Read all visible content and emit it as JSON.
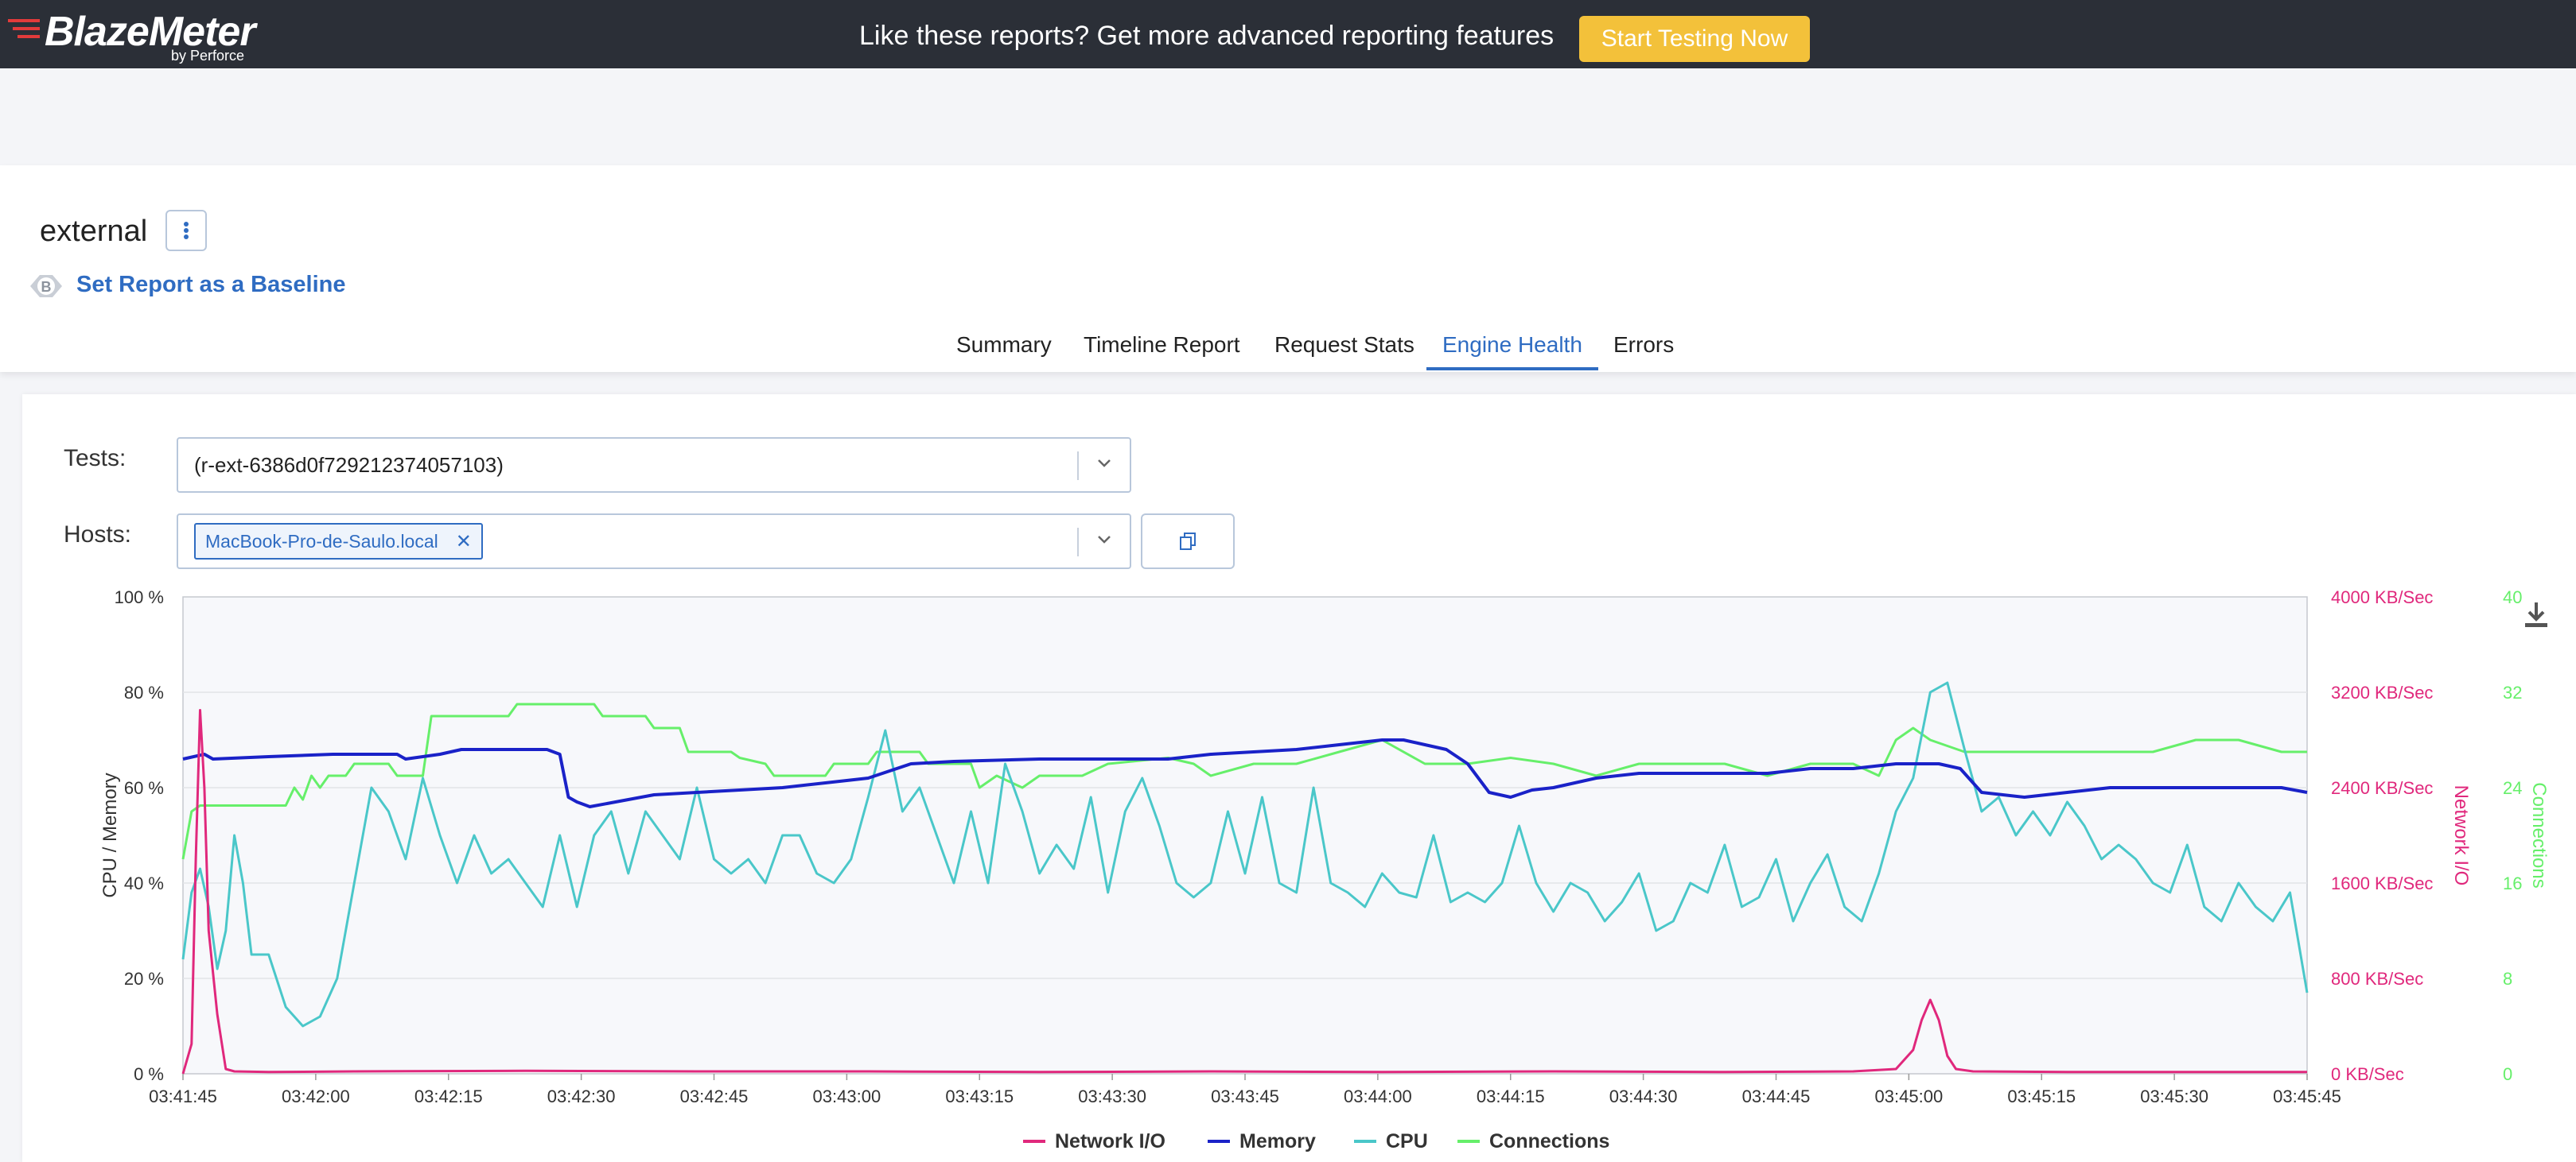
{
  "topbar": {
    "logo_text": "BlazeMeter",
    "logo_sub": "by Perforce",
    "promo_text": "Like these reports? Get more advanced reporting features",
    "cta_label": "Start Testing Now"
  },
  "report": {
    "title": "external",
    "baseline_link": "Set Report as a Baseline",
    "baseline_badge": "B"
  },
  "tabs": [
    {
      "label": "Summary"
    },
    {
      "label": "Timeline Report"
    },
    {
      "label": "Request Stats"
    },
    {
      "label": "Engine Health",
      "active": true
    },
    {
      "label": "Errors"
    }
  ],
  "filters": {
    "tests_label": "Tests:",
    "tests_value": "(r-ext-6386d0f729212374057103)",
    "hosts_label": "Hosts:",
    "hosts_chip": "MacBook-Pro-de-Saulo.local"
  },
  "colors": {
    "network": "#e0287c",
    "memory": "#1a22c8",
    "cpu": "#4ac7c9",
    "connections": "#66ef6a",
    "accent": "#2f6cc2",
    "cta": "#f3c13a"
  },
  "chart_data": {
    "type": "line",
    "ylabel_left": "CPU / Memory",
    "ylabel_right_1": "Network I/O",
    "ylabel_right_2": "Connections",
    "left_ticks": [
      "0 %",
      "20 %",
      "40 %",
      "60 %",
      "80 %",
      "100 %"
    ],
    "right1_ticks": [
      "0 KB/Sec",
      "800 KB/Sec",
      "1600 KB/Sec",
      "2400 KB/Sec",
      "3200 KB/Sec",
      "4000 KB/Sec"
    ],
    "right2_ticks": [
      "0",
      "8",
      "16",
      "24",
      "32",
      "40"
    ],
    "x_ticks": [
      "03:41:45",
      "03:42:00",
      "03:42:15",
      "03:42:30",
      "03:42:45",
      "03:43:00",
      "03:43:15",
      "03:43:30",
      "03:43:45",
      "03:44:00",
      "03:44:15",
      "03:44:30",
      "03:44:45",
      "03:45:00",
      "03:45:15",
      "03:45:30",
      "03:45:45"
    ],
    "x_range_seconds": [
      0,
      248
    ],
    "ylim_left": [
      0,
      100
    ],
    "ylim_network": [
      0,
      4000
    ],
    "ylim_connections": [
      0,
      40
    ],
    "grid": true,
    "legend_position": "bottom",
    "series": [
      {
        "name": "Network I/O",
        "axis": "network",
        "points": [
          [
            0,
            0
          ],
          [
            1,
            250
          ],
          [
            1.5,
            1800
          ],
          [
            2,
            3050
          ],
          [
            2.5,
            2400
          ],
          [
            3,
            1200
          ],
          [
            4,
            500
          ],
          [
            5,
            40
          ],
          [
            6,
            20
          ],
          [
            10,
            15
          ],
          [
            20,
            20
          ],
          [
            40,
            25
          ],
          [
            60,
            20
          ],
          [
            80,
            20
          ],
          [
            100,
            15
          ],
          [
            120,
            20
          ],
          [
            140,
            15
          ],
          [
            160,
            20
          ],
          [
            180,
            15
          ],
          [
            195,
            20
          ],
          [
            200,
            40
          ],
          [
            202,
            200
          ],
          [
            203,
            450
          ],
          [
            204,
            620
          ],
          [
            205,
            450
          ],
          [
            206,
            150
          ],
          [
            207,
            40
          ],
          [
            209,
            20
          ],
          [
            220,
            15
          ],
          [
            240,
            15
          ],
          [
            248,
            15
          ]
        ]
      },
      {
        "name": "Memory",
        "axis": "left",
        "points": [
          [
            0,
            66
          ],
          [
            5,
            67
          ],
          [
            7,
            66
          ],
          [
            20,
            66.5
          ],
          [
            35,
            67
          ],
          [
            50,
            67
          ],
          [
            52,
            66
          ],
          [
            60,
            67
          ],
          [
            65,
            68
          ],
          [
            75,
            68
          ],
          [
            85,
            68
          ],
          [
            88,
            67
          ],
          [
            90,
            58
          ],
          [
            92,
            57
          ],
          [
            95,
            56
          ],
          [
            110,
            58.5
          ],
          [
            120,
            59
          ],
          [
            130,
            59.5
          ],
          [
            140,
            60
          ],
          [
            150,
            61
          ],
          [
            160,
            62
          ],
          [
            170,
            65
          ],
          [
            180,
            65.5
          ],
          [
            200,
            66
          ],
          [
            210,
            66
          ],
          [
            220,
            66
          ],
          [
            230,
            66
          ],
          [
            240,
            67
          ],
          [
            250,
            67.5
          ],
          [
            260,
            68
          ],
          [
            270,
            69
          ],
          [
            280,
            70
          ],
          [
            285,
            70
          ],
          [
            290,
            69
          ],
          [
            295,
            68
          ],
          [
            300,
            65
          ],
          [
            305,
            59
          ],
          [
            310,
            58
          ],
          [
            315,
            59.5
          ],
          [
            320,
            60
          ],
          [
            330,
            62
          ],
          [
            340,
            63
          ],
          [
            350,
            63
          ],
          [
            360,
            63
          ],
          [
            370,
            63
          ],
          [
            380,
            64
          ],
          [
            390,
            64
          ],
          [
            400,
            65
          ],
          [
            410,
            65
          ],
          [
            415,
            64
          ],
          [
            420,
            59
          ],
          [
            430,
            58
          ],
          [
            440,
            59
          ],
          [
            450,
            60
          ],
          [
            460,
            60
          ],
          [
            470,
            60
          ],
          [
            480,
            60
          ],
          [
            490,
            60
          ],
          [
            496,
            59
          ]
        ]
      },
      {
        "name": "CPU",
        "axis": "left",
        "points": [
          [
            0,
            24
          ],
          [
            1,
            38
          ],
          [
            2,
            43
          ],
          [
            3,
            35
          ],
          [
            4,
            22
          ],
          [
            5,
            30
          ],
          [
            6,
            50
          ],
          [
            7,
            40
          ],
          [
            8,
            25
          ],
          [
            10,
            25
          ],
          [
            12,
            14
          ],
          [
            14,
            10
          ],
          [
            16,
            12
          ],
          [
            18,
            20
          ],
          [
            20,
            40
          ],
          [
            22,
            60
          ],
          [
            24,
            55
          ],
          [
            26,
            45
          ],
          [
            28,
            62
          ],
          [
            30,
            50
          ],
          [
            32,
            40
          ],
          [
            34,
            50
          ],
          [
            36,
            42
          ],
          [
            38,
            45
          ],
          [
            40,
            40
          ],
          [
            42,
            35
          ],
          [
            44,
            50
          ],
          [
            46,
            35
          ],
          [
            48,
            50
          ],
          [
            50,
            55
          ],
          [
            52,
            42
          ],
          [
            54,
            55
          ],
          [
            56,
            50
          ],
          [
            58,
            45
          ],
          [
            60,
            60
          ],
          [
            62,
            45
          ],
          [
            64,
            42
          ],
          [
            66,
            45
          ],
          [
            68,
            40
          ],
          [
            70,
            50
          ],
          [
            72,
            50
          ],
          [
            74,
            42
          ],
          [
            76,
            40
          ],
          [
            78,
            45
          ],
          [
            80,
            58
          ],
          [
            82,
            72
          ],
          [
            84,
            55
          ],
          [
            86,
            60
          ],
          [
            88,
            50
          ],
          [
            90,
            40
          ],
          [
            92,
            55
          ],
          [
            94,
            40
          ],
          [
            96,
            65
          ],
          [
            98,
            55
          ],
          [
            100,
            42
          ],
          [
            102,
            48
          ],
          [
            104,
            43
          ],
          [
            106,
            58
          ],
          [
            108,
            38
          ],
          [
            110,
            55
          ],
          [
            112,
            62
          ],
          [
            114,
            52
          ],
          [
            116,
            40
          ],
          [
            118,
            37
          ],
          [
            120,
            40
          ],
          [
            122,
            55
          ],
          [
            124,
            42
          ],
          [
            126,
            58
          ],
          [
            128,
            40
          ],
          [
            130,
            38
          ],
          [
            132,
            60
          ],
          [
            134,
            40
          ],
          [
            136,
            38
          ],
          [
            138,
            35
          ],
          [
            140,
            42
          ],
          [
            142,
            38
          ],
          [
            144,
            37
          ],
          [
            146,
            50
          ],
          [
            148,
            36
          ],
          [
            150,
            38
          ],
          [
            152,
            36
          ],
          [
            154,
            40
          ],
          [
            156,
            52
          ],
          [
            158,
            40
          ],
          [
            160,
            34
          ],
          [
            162,
            40
          ],
          [
            164,
            38
          ],
          [
            166,
            32
          ],
          [
            168,
            36
          ],
          [
            170,
            42
          ],
          [
            172,
            30
          ],
          [
            174,
            32
          ],
          [
            176,
            40
          ],
          [
            178,
            38
          ],
          [
            180,
            48
          ],
          [
            182,
            35
          ],
          [
            184,
            37
          ],
          [
            186,
            45
          ],
          [
            188,
            32
          ],
          [
            190,
            40
          ],
          [
            192,
            46
          ],
          [
            194,
            35
          ],
          [
            196,
            32
          ],
          [
            198,
            42
          ],
          [
            200,
            55
          ],
          [
            202,
            62
          ],
          [
            204,
            80
          ],
          [
            206,
            82
          ],
          [
            208,
            68
          ],
          [
            210,
            55
          ],
          [
            212,
            58
          ],
          [
            214,
            50
          ],
          [
            216,
            55
          ],
          [
            218,
            50
          ],
          [
            220,
            57
          ],
          [
            222,
            52
          ],
          [
            224,
            45
          ],
          [
            226,
            48
          ],
          [
            228,
            45
          ],
          [
            230,
            40
          ],
          [
            232,
            38
          ],
          [
            234,
            48
          ],
          [
            236,
            35
          ],
          [
            238,
            32
          ],
          [
            240,
            40
          ],
          [
            242,
            35
          ],
          [
            244,
            32
          ],
          [
            246,
            38
          ],
          [
            248,
            17
          ]
        ]
      },
      {
        "name": "Connections",
        "axis": "connections",
        "points": [
          [
            0,
            18
          ],
          [
            1,
            22
          ],
          [
            2,
            22.5
          ],
          [
            10,
            22.5
          ],
          [
            12,
            22.5
          ],
          [
            13,
            24
          ],
          [
            14,
            23
          ],
          [
            15,
            25
          ],
          [
            16,
            24
          ],
          [
            17,
            25
          ],
          [
            19,
            25
          ],
          [
            20,
            26
          ],
          [
            24,
            26
          ],
          [
            25,
            25
          ],
          [
            28,
            25
          ],
          [
            29,
            30
          ],
          [
            38,
            30
          ],
          [
            39,
            31
          ],
          [
            48,
            31
          ],
          [
            49,
            30
          ],
          [
            54,
            30
          ],
          [
            55,
            29
          ],
          [
            58,
            29
          ],
          [
            59,
            27
          ],
          [
            64,
            27
          ],
          [
            65,
            26.5
          ],
          [
            68,
            26
          ],
          [
            69,
            25
          ],
          [
            75,
            25
          ],
          [
            76,
            26
          ],
          [
            80,
            26
          ],
          [
            81,
            27
          ],
          [
            86,
            27
          ],
          [
            87,
            26
          ],
          [
            92,
            26
          ],
          [
            93,
            24
          ],
          [
            95,
            25
          ],
          [
            98,
            24
          ],
          [
            100,
            25
          ],
          [
            105,
            25
          ],
          [
            108,
            26
          ],
          [
            115,
            26.5
          ],
          [
            118,
            26
          ],
          [
            120,
            25
          ],
          [
            125,
            26
          ],
          [
            130,
            26
          ],
          [
            135,
            27
          ],
          [
            140,
            28
          ],
          [
            145,
            26
          ],
          [
            150,
            26
          ],
          [
            155,
            26.5
          ],
          [
            160,
            26
          ],
          [
            165,
            25
          ],
          [
            170,
            26
          ],
          [
            175,
            26
          ],
          [
            180,
            26
          ],
          [
            185,
            25
          ],
          [
            190,
            26
          ],
          [
            195,
            26
          ],
          [
            198,
            25
          ],
          [
            200,
            28
          ],
          [
            202,
            29
          ],
          [
            204,
            28
          ],
          [
            206,
            27.5
          ],
          [
            208,
            27
          ],
          [
            215,
            27
          ],
          [
            220,
            27
          ],
          [
            225,
            27
          ],
          [
            230,
            27
          ],
          [
            235,
            28
          ],
          [
            240,
            28
          ],
          [
            245,
            27
          ],
          [
            248,
            27
          ]
        ]
      }
    ]
  }
}
